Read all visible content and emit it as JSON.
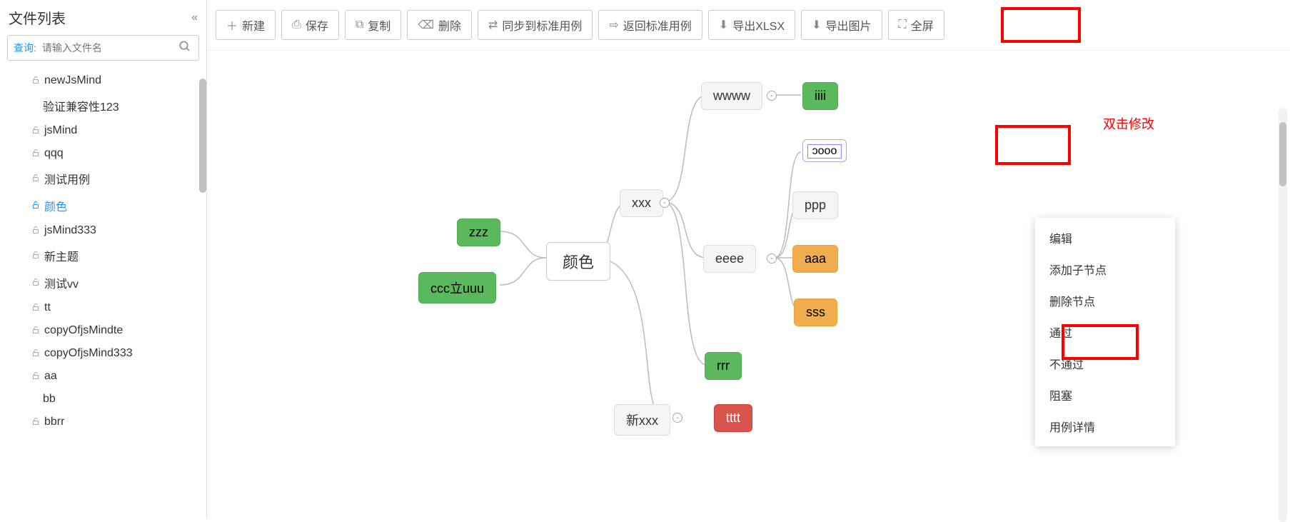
{
  "sidebar": {
    "title": "文件列表",
    "search_label": "查询:",
    "search_placeholder": "请输入文件名",
    "items": [
      {
        "label": "newJsMind",
        "locked": true,
        "child": false
      },
      {
        "label": "验证兼容性123",
        "locked": false,
        "child": true
      },
      {
        "label": "jsMind",
        "locked": true,
        "child": false
      },
      {
        "label": "qqq",
        "locked": true,
        "child": false
      },
      {
        "label": "测试用例",
        "locked": true,
        "child": false
      },
      {
        "label": "颜色",
        "locked": true,
        "child": false,
        "active": true
      },
      {
        "label": "jsMind333",
        "locked": true,
        "child": false
      },
      {
        "label": "新主题",
        "locked": true,
        "child": false
      },
      {
        "label": "测试vv",
        "locked": true,
        "child": false
      },
      {
        "label": "tt",
        "locked": true,
        "child": false
      },
      {
        "label": "copyOfjsMindte",
        "locked": true,
        "child": false
      },
      {
        "label": "copyOfjsMind333",
        "locked": true,
        "child": false
      },
      {
        "label": "aa",
        "locked": true,
        "child": false
      },
      {
        "label": "bb",
        "locked": false,
        "child": true
      },
      {
        "label": "bbrr",
        "locked": true,
        "child": false
      }
    ]
  },
  "toolbar": {
    "new": "新建",
    "save": "保存",
    "copy": "复制",
    "delete": "删除",
    "sync": "同步到标准用例",
    "back": "返回标准用例",
    "export_xlsx": "导出XLSX",
    "export_image": "导出图片",
    "fullscreen": "全屏"
  },
  "annotation": {
    "double_click_edit": "双击修改"
  },
  "mindmap": {
    "root": "颜色",
    "nodes": {
      "zzz": "zzz",
      "cccuuu": "ccc立uuu",
      "xxx": "xxx",
      "newxxx": "新xxx",
      "wwww": "wwww",
      "eeee": "eeee",
      "rrr": "rrr",
      "iiii": "iiii",
      "oooo": "ɔooo",
      "ppp": "ppp",
      "aaa": "aaa",
      "sss": "sss",
      "tttt": "tttt"
    }
  },
  "context_menu": {
    "items": [
      "编辑",
      "添加子节点",
      "删除节点",
      "通过",
      "不通过",
      "阻塞",
      "用例详情"
    ]
  }
}
